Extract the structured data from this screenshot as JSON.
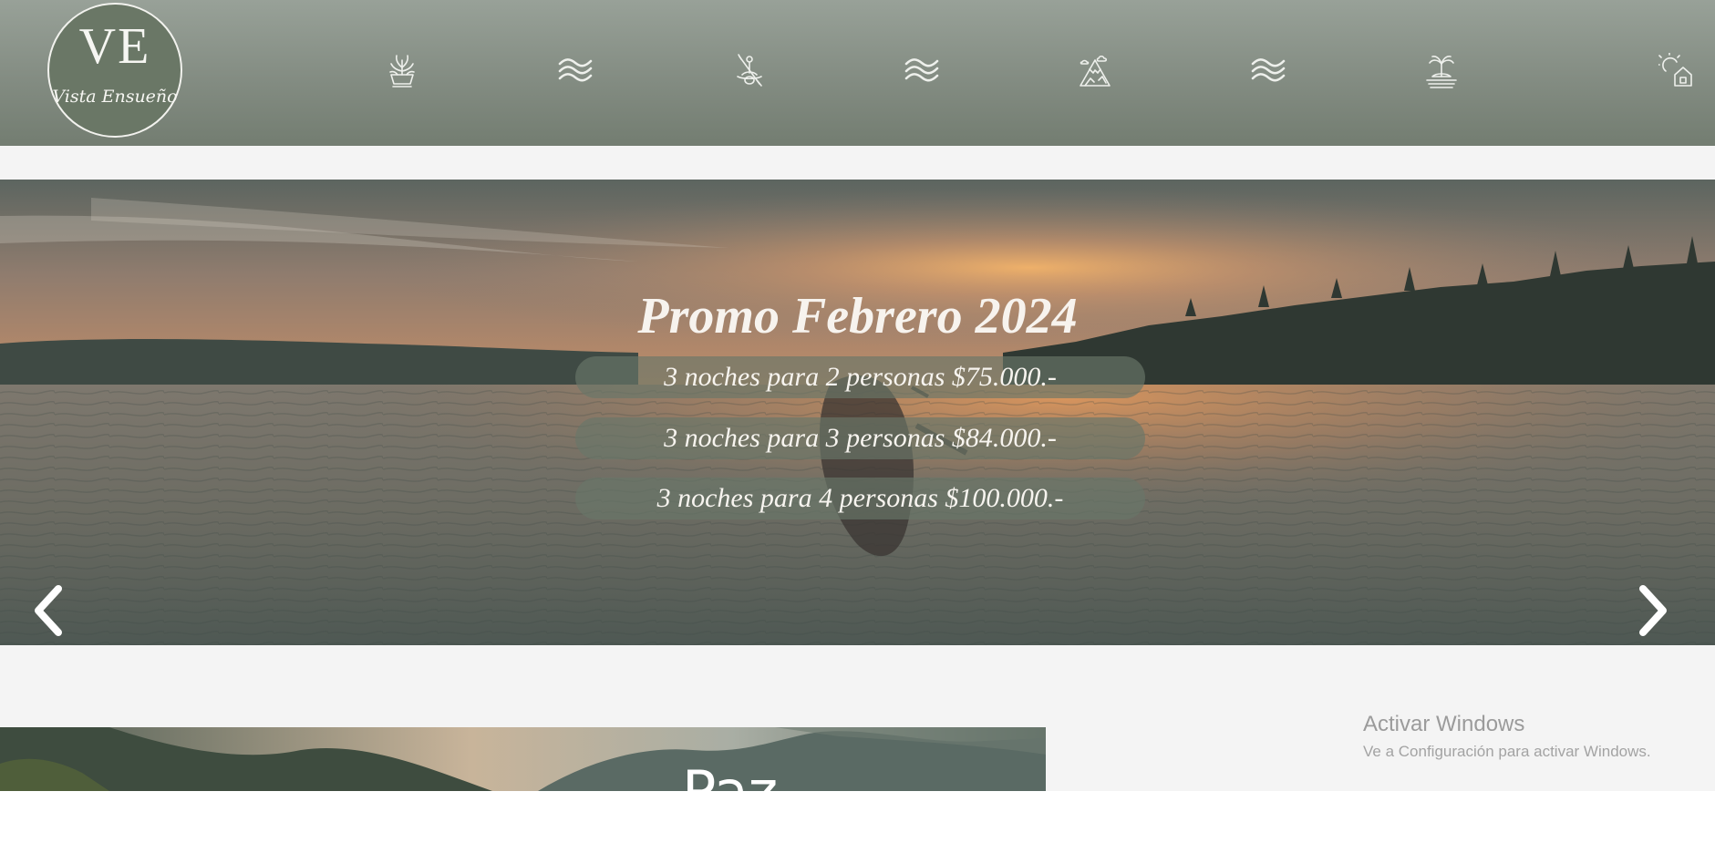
{
  "logo": {
    "monogram": "VE",
    "name": "Vista Ensueño"
  },
  "nav": {
    "icons": [
      "plant-pot-icon",
      "waves-icon",
      "kayak-icon",
      "waves-icon",
      "mountain-icon",
      "waves-icon",
      "island-icon",
      "sun-house-icon"
    ]
  },
  "slider": {
    "title": "Promo Febrero 2024",
    "offers": [
      "3 noches para 2 personas $75.000.-",
      "3 noches para 3 personas $84.000.-",
      "3 noches para 4 personas $100.000.-"
    ],
    "prev_icon": "chevron-left-icon",
    "next_icon": "chevron-right-icon"
  },
  "section2": {
    "title": "Paz"
  },
  "windows_watermark": {
    "title": "Activar Windows",
    "subtitle": "Ve a Configuración para activar Windows."
  },
  "colors": {
    "header_top": "#98a198",
    "header_bottom": "#737d71",
    "pill_bg": "#687668",
    "page_bg": "#f4f4f4",
    "text_light": "#f7f4ef"
  }
}
